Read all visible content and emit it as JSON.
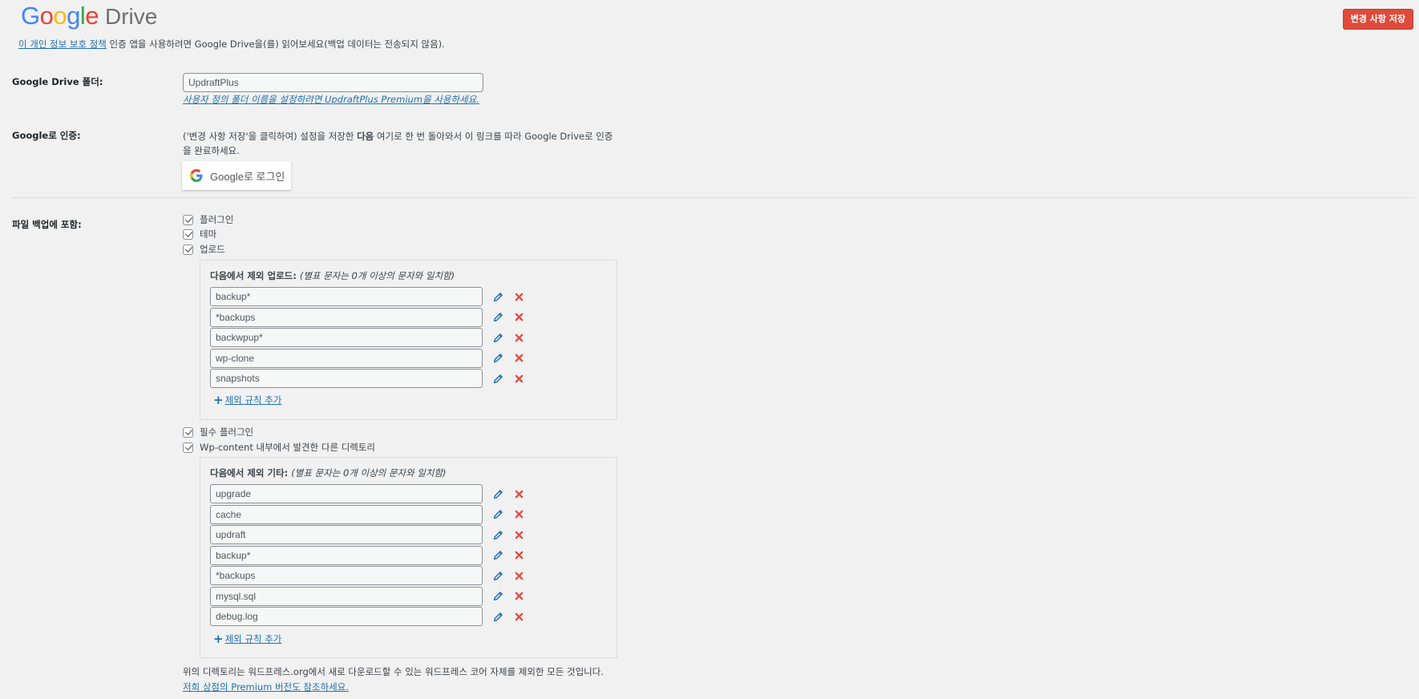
{
  "header": {
    "logo_google": "Google",
    "logo_drive": "Drive",
    "save_button": "변경 사항 저장",
    "privacy_link": "이 개인 정보 보호 정책",
    "privacy_text": " 인증 앱을 사용하려면 Google Drive을(를) 읽어보세요(백업 데이터는 전송되지 않음)."
  },
  "folder": {
    "label": "Google Drive 폴더:",
    "value": "UpdraftPlus",
    "premium_link": "사용자 정의 폴더 이름을 설정하려면 UpdraftPlus Premium을 사용하세요."
  },
  "auth": {
    "label": "Google로 인증:",
    "text_before": "('변경 사항 저장'을 클릭하여) 설정을 저장한 ",
    "text_bold": "다음",
    "text_after": " 여기로 한 번 돌아와서 이 링크를 따라 Google Drive로 인증을 완료하세요.",
    "login_button": "Google로 로그인"
  },
  "include": {
    "label": "파일 백업에 포함:",
    "checkboxes_top": [
      {
        "label": "플러그인",
        "checked": true
      },
      {
        "label": "테마",
        "checked": true
      },
      {
        "label": "업로드",
        "checked": true
      }
    ],
    "uploads_exclude": {
      "title": "다음에서 제외 업로드:",
      "hint": "(별표 문자는 0개 이상의 문자와 일치함)",
      "rules": [
        "backup*",
        "*backups",
        "backwpup*",
        "wp-clone",
        "snapshots"
      ],
      "add_rule": "제외 규칙 추가"
    },
    "checkboxes_mid": [
      {
        "label": "필수 플러그인",
        "checked": true
      },
      {
        "label": "Wp-content 내부에서 발견한 다른 디렉토리",
        "checked": true
      }
    ],
    "others_exclude": {
      "title": "다음에서 제외 기타:",
      "hint": "(별표 문자는 0개 이상의 문자와 일치함)",
      "rules": [
        "upgrade",
        "cache",
        "updraft",
        "backup*",
        "*backups",
        "mysql.sql",
        "debug.log"
      ],
      "add_rule": "제외 규칙 추가"
    },
    "footer_text": "위의 디렉토리는 워드프레스.org에서 새로 다운로드할 수 있는 워드프레스 코어 자체를 제외한 모든 것입니다.",
    "footer_link": "저희 상점의 Premium 버전도 참조하세요."
  },
  "colors": {
    "accent_link": "#2271b1",
    "save_button": "#df4b3a",
    "delete_icon": "#e14d43"
  }
}
